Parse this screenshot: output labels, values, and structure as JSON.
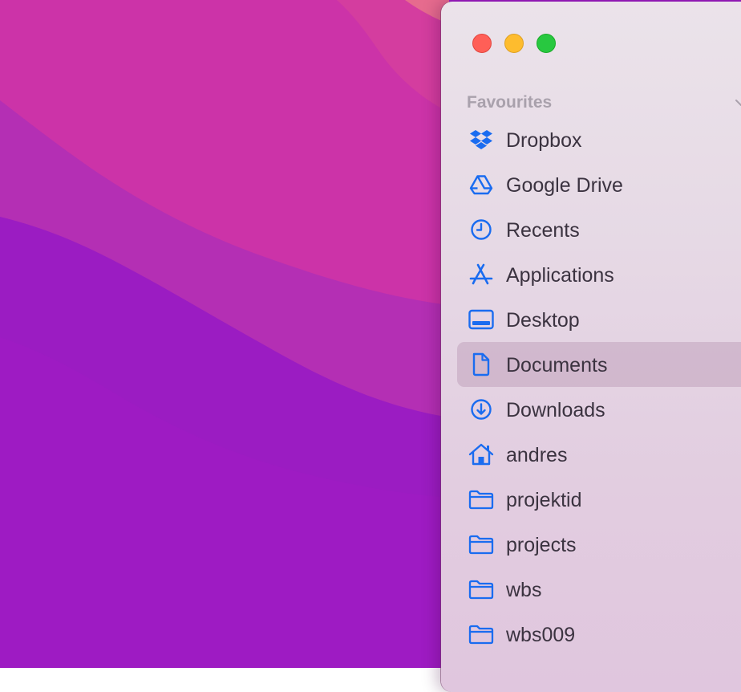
{
  "wallpaper": {
    "colors": [
      "#c4248f",
      "#d13aa6",
      "#b52fb3",
      "#a51eb8",
      "#9b1cc2"
    ]
  },
  "window": {
    "traffic_lights": [
      {
        "name": "close",
        "color": "#ff5f57"
      },
      {
        "name": "minimize",
        "color": "#febc2e"
      },
      {
        "name": "zoom",
        "color": "#28c840"
      }
    ]
  },
  "sidebar": {
    "accent_color": "#1a6cf0",
    "section_title": "Favourites",
    "items": [
      {
        "label": "Dropbox",
        "icon": "dropbox-icon"
      },
      {
        "label": "Google Drive",
        "icon": "google-drive-icon"
      },
      {
        "label": "Recents",
        "icon": "clock-icon"
      },
      {
        "label": "Applications",
        "icon": "applications-icon"
      },
      {
        "label": "Desktop",
        "icon": "desktop-icon"
      },
      {
        "label": "Documents",
        "icon": "document-icon",
        "selected": true
      },
      {
        "label": "Downloads",
        "icon": "download-icon"
      },
      {
        "label": "andres",
        "icon": "home-icon"
      },
      {
        "label": "projektid",
        "icon": "folder-icon"
      },
      {
        "label": "projects",
        "icon": "folder-icon"
      },
      {
        "label": "wbs",
        "icon": "folder-icon"
      },
      {
        "label": "wbs009",
        "icon": "folder-icon"
      }
    ]
  }
}
